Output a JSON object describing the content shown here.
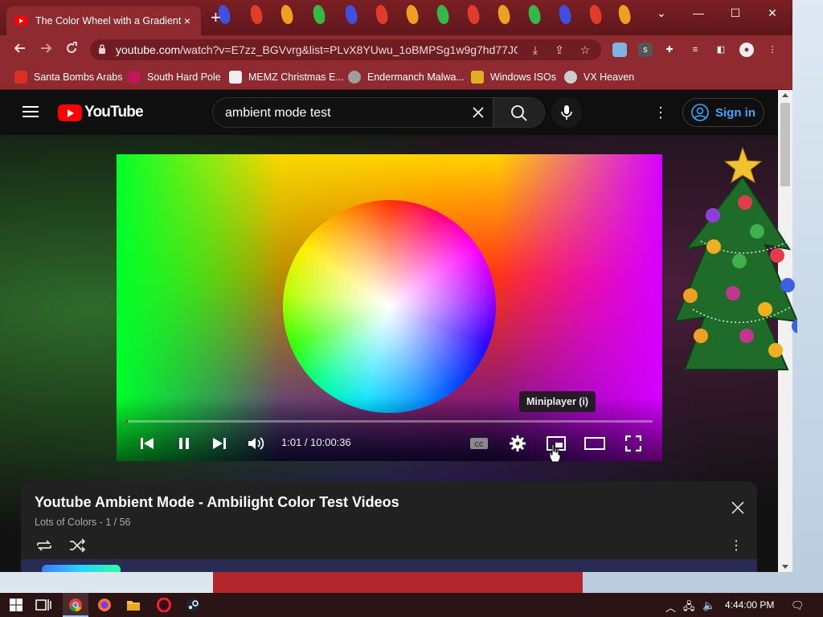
{
  "browser": {
    "tab_title": "The Color Wheel with a Gradient",
    "tab_close": "×",
    "new_tab": "+",
    "url_host": "youtube.com",
    "url_path": "/watch?v=E7zz_BGVvrg&list=PLvX8YUwu_1oBMPSg1w9g7hd77JO...",
    "window": {
      "minimize": "—",
      "maximize": "☐",
      "close": "✕",
      "collapse": "⌄"
    }
  },
  "bookmarks": [
    {
      "label": "Santa Bombs Arabs",
      "color": "#d93025"
    },
    {
      "label": "South Hard Pole",
      "color": "#c2185b"
    },
    {
      "label": "MEMZ Christmas E...",
      "color": "#eeeeee"
    },
    {
      "label": "Endermanch Malwa...",
      "color": "#9e9e9e"
    },
    {
      "label": "Windows ISOs",
      "color": "#e0b020"
    },
    {
      "label": "VX Heaven",
      "color": "#cccccc"
    }
  ],
  "youtube": {
    "logo_text": "YouTube",
    "search_value": "ambient mode test",
    "sign_in": "Sign in",
    "accent": "#3ea6ff",
    "brand_red": "#ff0000"
  },
  "player": {
    "time": "1:01 / 10:00:36",
    "progress_fraction": 0.0017,
    "tooltip": "Miniplayer (i)",
    "cc_label": "CC"
  },
  "playlist": {
    "title": "Youtube Ambient Mode - Ambilight Color Test Videos",
    "subtitle": "Lots of Colors - 1 / 56"
  },
  "taskbar": {
    "time": "4:44:00 PM"
  }
}
